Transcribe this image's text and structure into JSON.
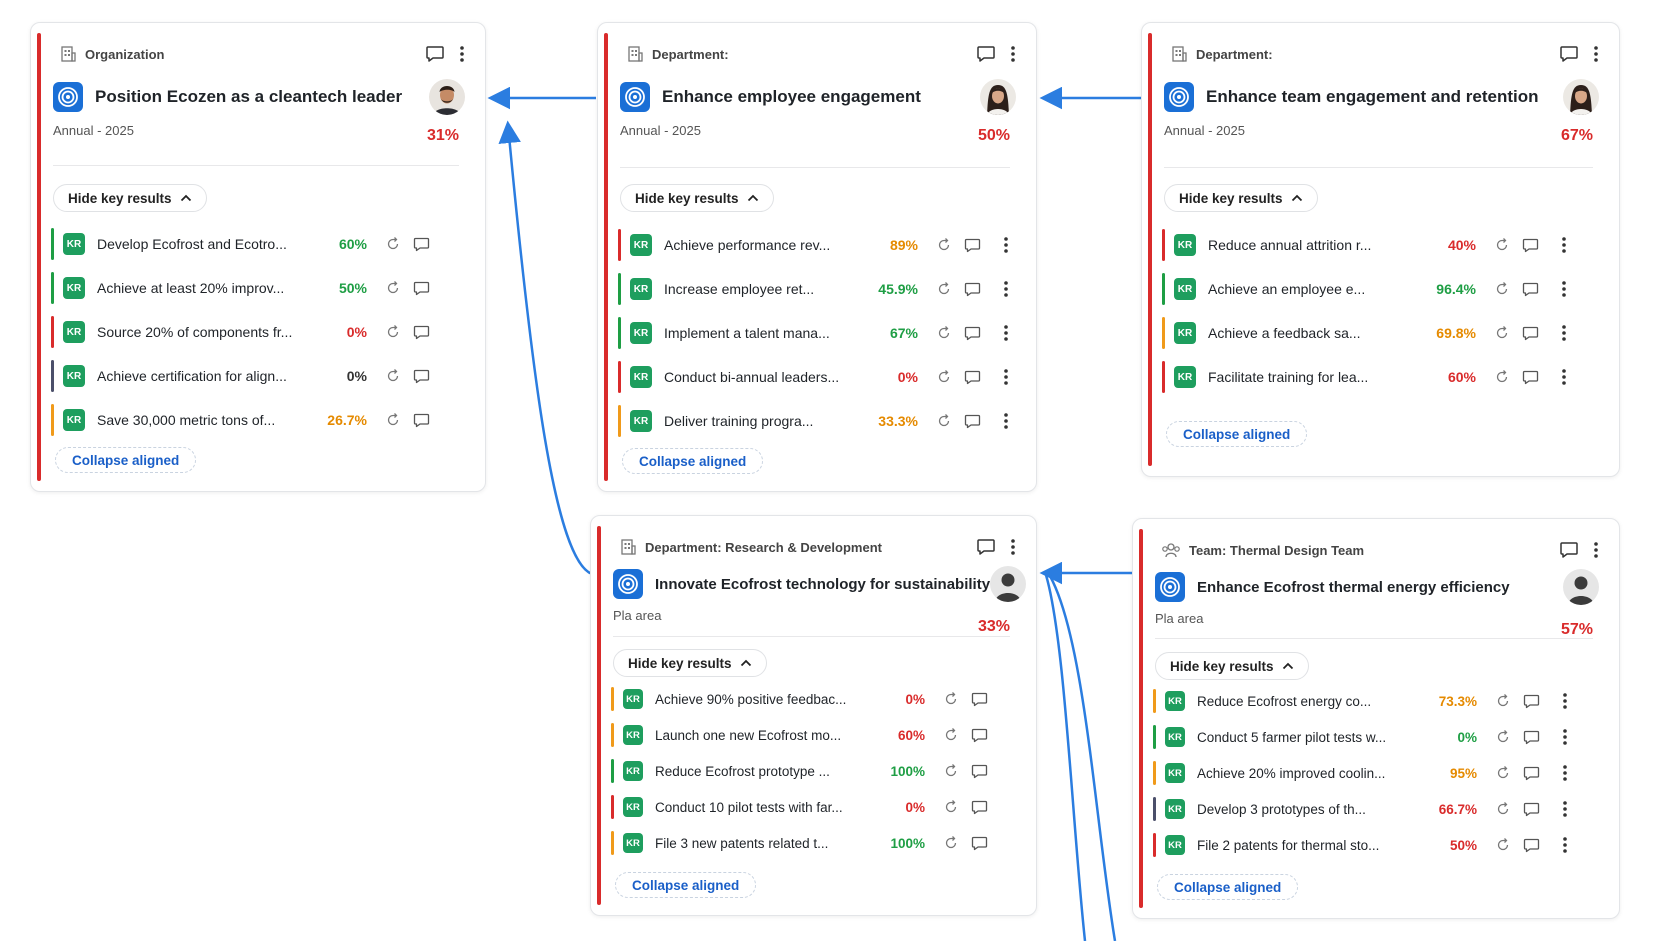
{
  "labels": {
    "hide": "Hide key results",
    "collapse": "Collapse aligned",
    "kr": "KR"
  },
  "colors": {
    "red": "#d92b2b",
    "green": "#1e9e44",
    "orange": "#f09a1a",
    "dark": "#4b4f6a",
    "blue": "#1a6fd6",
    "arrow": "#2b7de0"
  },
  "cards": [
    {
      "type_icon": "building-icon",
      "type": "Organization",
      "title": "Position Ecozen as a cleantech leader",
      "period": "Annual - 2025",
      "progress": "31%",
      "avatar": "avatar-man",
      "krs": [
        {
          "text": "Develop Ecofrost and Ecotro...",
          "pct": "60%",
          "status": "green"
        },
        {
          "text": "Achieve at least 20% improv...",
          "pct": "50%",
          "status": "green"
        },
        {
          "text": "Source 20% of components fr...",
          "pct": "0%",
          "status": "red"
        },
        {
          "text": "Achieve certification for align...",
          "pct": "0%",
          "status": "dark"
        },
        {
          "text": "Save 30,000 metric tons of...",
          "pct": "26.7%",
          "status": "orange"
        }
      ]
    },
    {
      "type_icon": "building-icon",
      "type": "Department:",
      "title": "Enhance employee engagement",
      "period": "Annual - 2025",
      "progress": "50%",
      "avatar": "avatar-woman",
      "krs": [
        {
          "text": "Achieve performance rev...",
          "pct": "89%",
          "status": "red",
          "pct_color": "orange"
        },
        {
          "text": "Increase employee ret...",
          "pct": "45.9%",
          "status": "green"
        },
        {
          "text": "Implement a talent mana...",
          "pct": "67%",
          "status": "green"
        },
        {
          "text": "Conduct bi-annual leaders...",
          "pct": "0%",
          "status": "red"
        },
        {
          "text": "Deliver training progra...",
          "pct": "33.3%",
          "status": "orange"
        }
      ]
    },
    {
      "type_icon": "building-icon",
      "type": "Department:",
      "title": "Enhance team engagement and retention",
      "period": "Annual - 2025",
      "progress": "67%",
      "avatar": "avatar-woman",
      "krs": [
        {
          "text": "Reduce annual attrition r...",
          "pct": "40%",
          "status": "red"
        },
        {
          "text": "Achieve an employee e...",
          "pct": "96.4%",
          "status": "green"
        },
        {
          "text": "Achieve a feedback sa...",
          "pct": "69.8%",
          "status": "orange"
        },
        {
          "text": "Facilitate training for lea...",
          "pct": "60%",
          "status": "red"
        }
      ]
    },
    {
      "type_icon": "building-icon",
      "type": "Department: Research & Development",
      "title": "Innovate Ecofrost technology for sustainability",
      "period": "Pla area",
      "progress": "33%",
      "avatar": "avatar-default",
      "krs": [
        {
          "text": "Achieve 90% positive feedbac...",
          "pct": "0%",
          "status": "orange",
          "pct_color": "red"
        },
        {
          "text": "Launch one new Ecofrost mo...",
          "pct": "60%",
          "status": "orange",
          "pct_color": "red"
        },
        {
          "text": "Reduce Ecofrost prototype ...",
          "pct": "100%",
          "status": "green"
        },
        {
          "text": "Conduct 10 pilot tests with far...",
          "pct": "0%",
          "status": "red"
        },
        {
          "text": "File 3 new patents related t...",
          "pct": "100%",
          "status": "orange",
          "pct_color": "green"
        }
      ]
    },
    {
      "type_icon": "team-icon",
      "type": "Team: Thermal Design Team",
      "title": "Enhance Ecofrost thermal energy efficiency",
      "period": "Pla area",
      "progress": "57%",
      "avatar": "avatar-default",
      "krs": [
        {
          "text": "Reduce Ecofrost energy co...",
          "pct": "73.3%",
          "status": "orange"
        },
        {
          "text": "Conduct 5 farmer pilot tests w...",
          "pct": "0%",
          "status": "green",
          "pct_color": "green"
        },
        {
          "text": "Achieve 20% improved coolin...",
          "pct": "95%",
          "status": "orange"
        },
        {
          "text": "Develop 3 prototypes of th...",
          "pct": "66.7%",
          "status": "dark",
          "pct_color": "red"
        },
        {
          "text": "File 2 patents for thermal sto...",
          "pct": "50%",
          "status": "red"
        }
      ]
    }
  ]
}
